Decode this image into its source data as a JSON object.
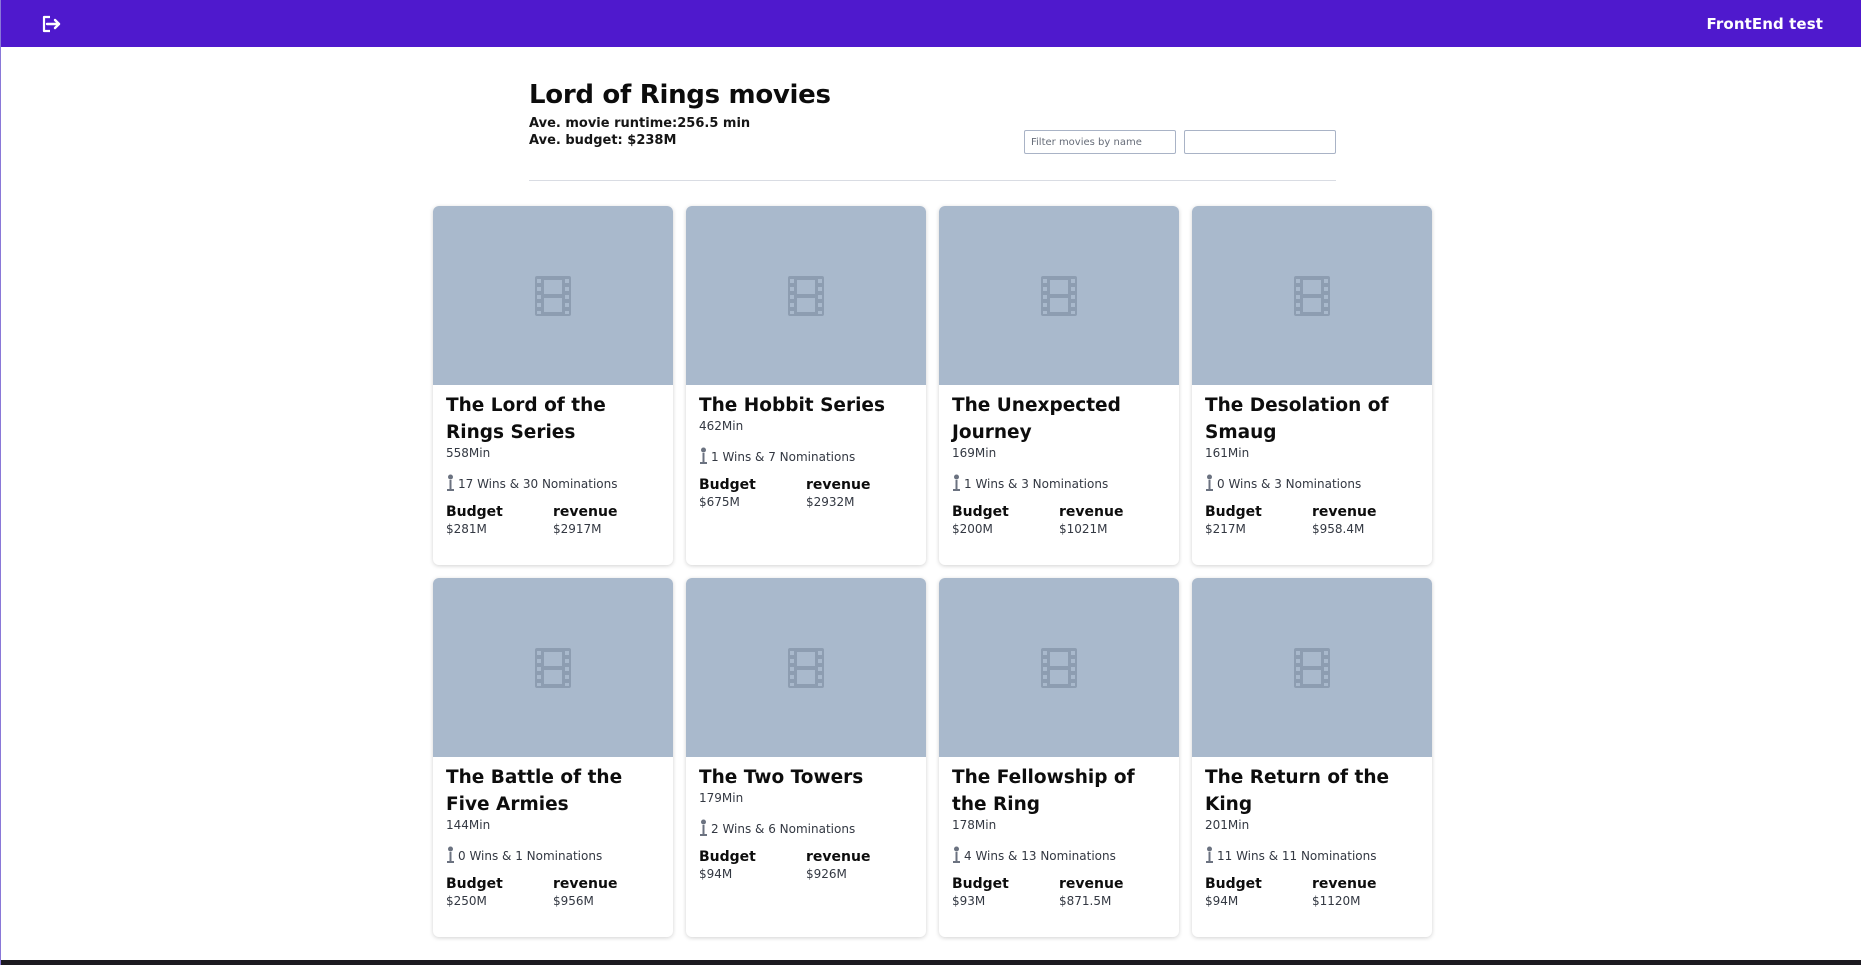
{
  "app": {
    "brand": "FrontEnd test",
    "logo_icon": "exit-arrow-icon"
  },
  "colors": {
    "topbar": "#4f19cd",
    "poster_placeholder": "#a9b9cc"
  },
  "header": {
    "title": "Lord of Rings movies",
    "avg_runtime": "Ave. movie runtime:256.5 min",
    "avg_budget": "Ave. budget: $238M"
  },
  "filters": {
    "name_placeholder": "Filter movies by name",
    "second_placeholder": ""
  },
  "labels": {
    "budget": "Budget",
    "revenue": "revenue"
  },
  "movies": [
    {
      "title": "The Lord of the Rings Series",
      "runtime": "558Min",
      "awards": "17 Wins & 30 Nominations",
      "budget": "$281M",
      "revenue": "$2917M"
    },
    {
      "title": "The Hobbit Series",
      "runtime": "462Min",
      "awards": "1 Wins & 7 Nominations",
      "budget": "$675M",
      "revenue": "$2932M"
    },
    {
      "title": "The Unexpected Journey",
      "runtime": "169Min",
      "awards": "1 Wins & 3 Nominations",
      "budget": "$200M",
      "revenue": "$1021M"
    },
    {
      "title": "The Desolation of Smaug",
      "runtime": "161Min",
      "awards": "0 Wins & 3 Nominations",
      "budget": "$217M",
      "revenue": "$958.4M"
    },
    {
      "title": "The Battle of the Five Armies",
      "runtime": "144Min",
      "awards": "0 Wins & 1 Nominations",
      "budget": "$250M",
      "revenue": "$956M"
    },
    {
      "title": "The Two Towers",
      "runtime": "179Min",
      "awards": "2 Wins & 6 Nominations",
      "budget": "$94M",
      "revenue": "$926M"
    },
    {
      "title": "The Fellowship of the Ring",
      "runtime": "178Min",
      "awards": "4 Wins & 13 Nominations",
      "budget": "$93M",
      "revenue": "$871.5M"
    },
    {
      "title": "The Return of the King",
      "runtime": "201Min",
      "awards": "11 Wins & 11 Nominations",
      "budget": "$94M",
      "revenue": "$1120M"
    }
  ]
}
